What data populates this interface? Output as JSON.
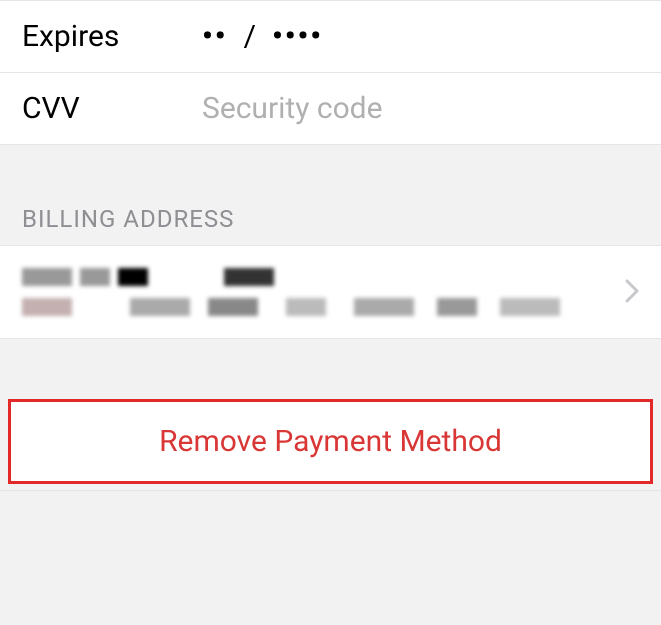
{
  "card": {
    "expires_label": "Expires",
    "expires_month_mask": "••",
    "expires_separator": "/",
    "expires_year_mask": "••••",
    "cvv_label": "CVV",
    "cvv_placeholder": "Security code"
  },
  "billing": {
    "section_title": "BILLING ADDRESS"
  },
  "actions": {
    "remove_label": "Remove Payment Method"
  }
}
